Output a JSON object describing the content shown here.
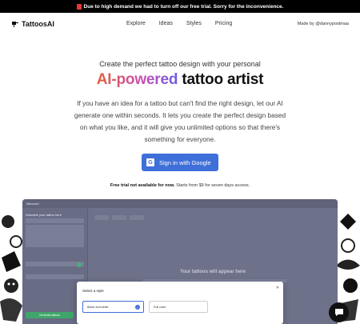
{
  "banner": {
    "text": "Due to high demand we had to turn off our free trial. Sorry for the inconvenience."
  },
  "nav": {
    "logo": "TattoosAI",
    "items": [
      {
        "label": "Explore"
      },
      {
        "label": "Ideas"
      },
      {
        "label": "Styles"
      },
      {
        "label": "Pricing"
      }
    ],
    "made_by": "Made by @dannypostmaa"
  },
  "hero": {
    "subtitle": "Create the perfect tattoo design with your personal",
    "title_gradient": "AI-powered",
    "title_rest": " tattoo artist",
    "description": "If you have an idea for a tattoo but can't find the right design, let our AI generate one within seconds. It lets you create the perfect design based on what you like, and it will give you unlimited options so that there's something for everyone.",
    "google_button": "Sign in with Google",
    "trial_bold": "Free trial not available for now.",
    "trial_rest": " Starts from $9 for seven days access."
  },
  "app_preview": {
    "app_name": "TattoosAI",
    "sidebar_title": "Describe your tattoo here",
    "main_placeholder": "Your tattoos will appear here",
    "generate_button": "Generate tattoos",
    "modal": {
      "title": "Select a style",
      "options": [
        "Black and white",
        "Full color"
      ],
      "selected": "Black and white"
    }
  },
  "colors": {
    "accent": "#3f6fd8",
    "brand_gradient": [
      "#e0603a",
      "#c94fb0",
      "#6c5ce7"
    ]
  }
}
